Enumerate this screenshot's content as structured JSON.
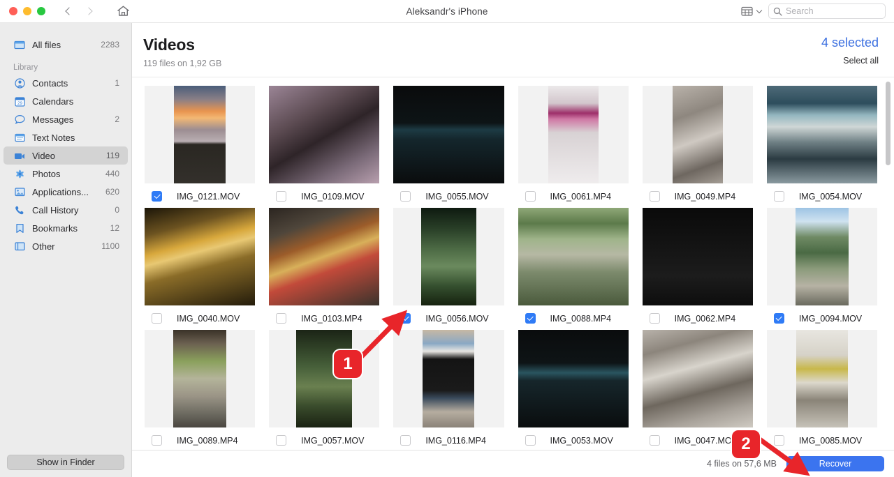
{
  "window": {
    "title": "Aleksandr's iPhone",
    "nav": {
      "back": "‹",
      "forward": "›",
      "home_icon": "home-icon"
    }
  },
  "toolbar": {
    "view_icon": "grid-view-icon",
    "view_chevron": "chevron-down-icon",
    "search_placeholder": "Search",
    "search_value": "",
    "search_icon": "search-icon"
  },
  "sidebar": {
    "top": {
      "label": "All files",
      "count": "2283",
      "icon": "all-files-icon"
    },
    "section_label": "Library",
    "items": [
      {
        "label": "Contacts",
        "count": "1",
        "icon": "contacts-icon",
        "selected": false
      },
      {
        "label": "Calendars",
        "count": "",
        "icon": "calendar-icon",
        "selected": false
      },
      {
        "label": "Messages",
        "count": "2",
        "icon": "messages-icon",
        "selected": false
      },
      {
        "label": "Text Notes",
        "count": "",
        "icon": "notes-icon",
        "selected": false
      },
      {
        "label": "Video",
        "count": "119",
        "icon": "video-icon",
        "selected": true
      },
      {
        "label": "Photos",
        "count": "440",
        "icon": "photos-icon",
        "selected": false
      },
      {
        "label": "Applications...",
        "count": "620",
        "icon": "applications-icon",
        "selected": false
      },
      {
        "label": "Call History",
        "count": "0",
        "icon": "phone-icon",
        "selected": false
      },
      {
        "label": "Bookmarks",
        "count": "12",
        "icon": "bookmark-icon",
        "selected": false
      },
      {
        "label": "Other",
        "count": "1100",
        "icon": "other-icon",
        "selected": false
      }
    ],
    "show_in_finder": "Show in Finder"
  },
  "content": {
    "title": "Videos",
    "subtitle": "119 files on 1,92 GB",
    "selected_count": "4 selected",
    "select_all": "Select all"
  },
  "files": [
    {
      "name": "IMG_0121.MOV",
      "checked": true,
      "art": "a1"
    },
    {
      "name": "IMG_0109.MOV",
      "checked": false,
      "art": "a2"
    },
    {
      "name": "IMG_0055.MOV",
      "checked": false,
      "art": "a3"
    },
    {
      "name": "IMG_0061.MP4",
      "checked": false,
      "art": "a4"
    },
    {
      "name": "IMG_0049.MP4",
      "checked": false,
      "art": "a5"
    },
    {
      "name": "IMG_0054.MOV",
      "checked": false,
      "art": "a6"
    },
    {
      "name": "IMG_0040.MOV",
      "checked": false,
      "art": "a7"
    },
    {
      "name": "IMG_0103.MP4",
      "checked": false,
      "art": "a8"
    },
    {
      "name": "IMG_0056.MOV",
      "checked": true,
      "art": "a9"
    },
    {
      "name": "IMG_0088.MP4",
      "checked": true,
      "art": "a10"
    },
    {
      "name": "IMG_0062.MP4",
      "checked": false,
      "art": "a11"
    },
    {
      "name": "IMG_0094.MOV",
      "checked": true,
      "art": "a12"
    },
    {
      "name": "IMG_0089.MP4",
      "checked": false,
      "art": "a13"
    },
    {
      "name": "IMG_0057.MOV",
      "checked": false,
      "art": "a14"
    },
    {
      "name": "IMG_0116.MP4",
      "checked": false,
      "art": "a15"
    },
    {
      "name": "IMG_0053.MOV",
      "checked": false,
      "art": "a16"
    },
    {
      "name": "IMG_0047.MOV",
      "checked": false,
      "art": "a17"
    },
    {
      "name": "IMG_0085.MOV",
      "checked": false,
      "art": "a18"
    }
  ],
  "footer": {
    "status": "4 files on 57,6 MB",
    "recover": "Recover"
  },
  "annotations": [
    {
      "label": "1"
    },
    {
      "label": "2"
    }
  ],
  "colors": {
    "accent": "#3b74ef",
    "selected_text": "#3b6fe0",
    "annotation": "#e8252a",
    "sidebar_bg": "#ececec"
  }
}
